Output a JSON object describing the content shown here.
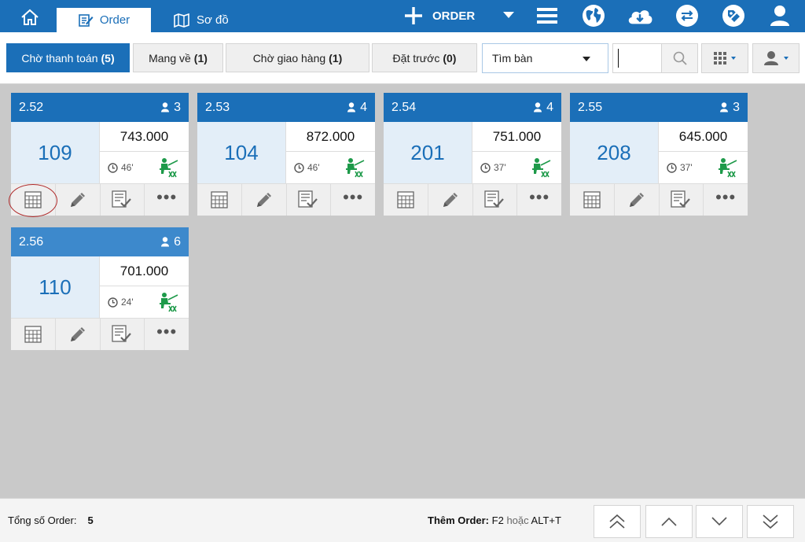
{
  "topbar": {
    "home_icon": "home-icon",
    "tab_order_label": "Order",
    "tab_sodo_label": "Sơ đồ",
    "new_order_label": "ORDER",
    "icons": [
      "menu-icon",
      "globe-icon",
      "cloud-download-icon",
      "sync-icon",
      "tag-icon",
      "user-icon"
    ],
    "accent": "#1b6fb8"
  },
  "filters": {
    "tabs": [
      {
        "label": "Chờ thanh toán",
        "count": "(5)"
      },
      {
        "label": "Mang về",
        "count": "(1)"
      },
      {
        "label": "Chờ giao hàng",
        "count": "(1)"
      },
      {
        "label": "Đặt trước",
        "count": "(0)"
      }
    ],
    "table_select": "Tìm bàn",
    "search_value": ""
  },
  "cards": [
    {
      "order": "2.52",
      "guests": "3",
      "table": "109",
      "amount": "743.000",
      "time": "46'"
    },
    {
      "order": "2.53",
      "guests": "4",
      "table": "104",
      "amount": "872.000",
      "time": "46'"
    },
    {
      "order": "2.54",
      "guests": "4",
      "table": "201",
      "amount": "751.000",
      "time": "37'"
    },
    {
      "order": "2.55",
      "guests": "3",
      "table": "208",
      "amount": "645.000",
      "time": "37'"
    },
    {
      "order": "2.56",
      "guests": "6",
      "table": "110",
      "amount": "701.000",
      "time": "24'"
    }
  ],
  "footer": {
    "total_label": "Tổng số Order:",
    "total_value": "5",
    "hint_label": "Thêm Order:",
    "hint_key1": "F2",
    "hint_or": "hoặc",
    "hint_key2": "ALT+T"
  }
}
